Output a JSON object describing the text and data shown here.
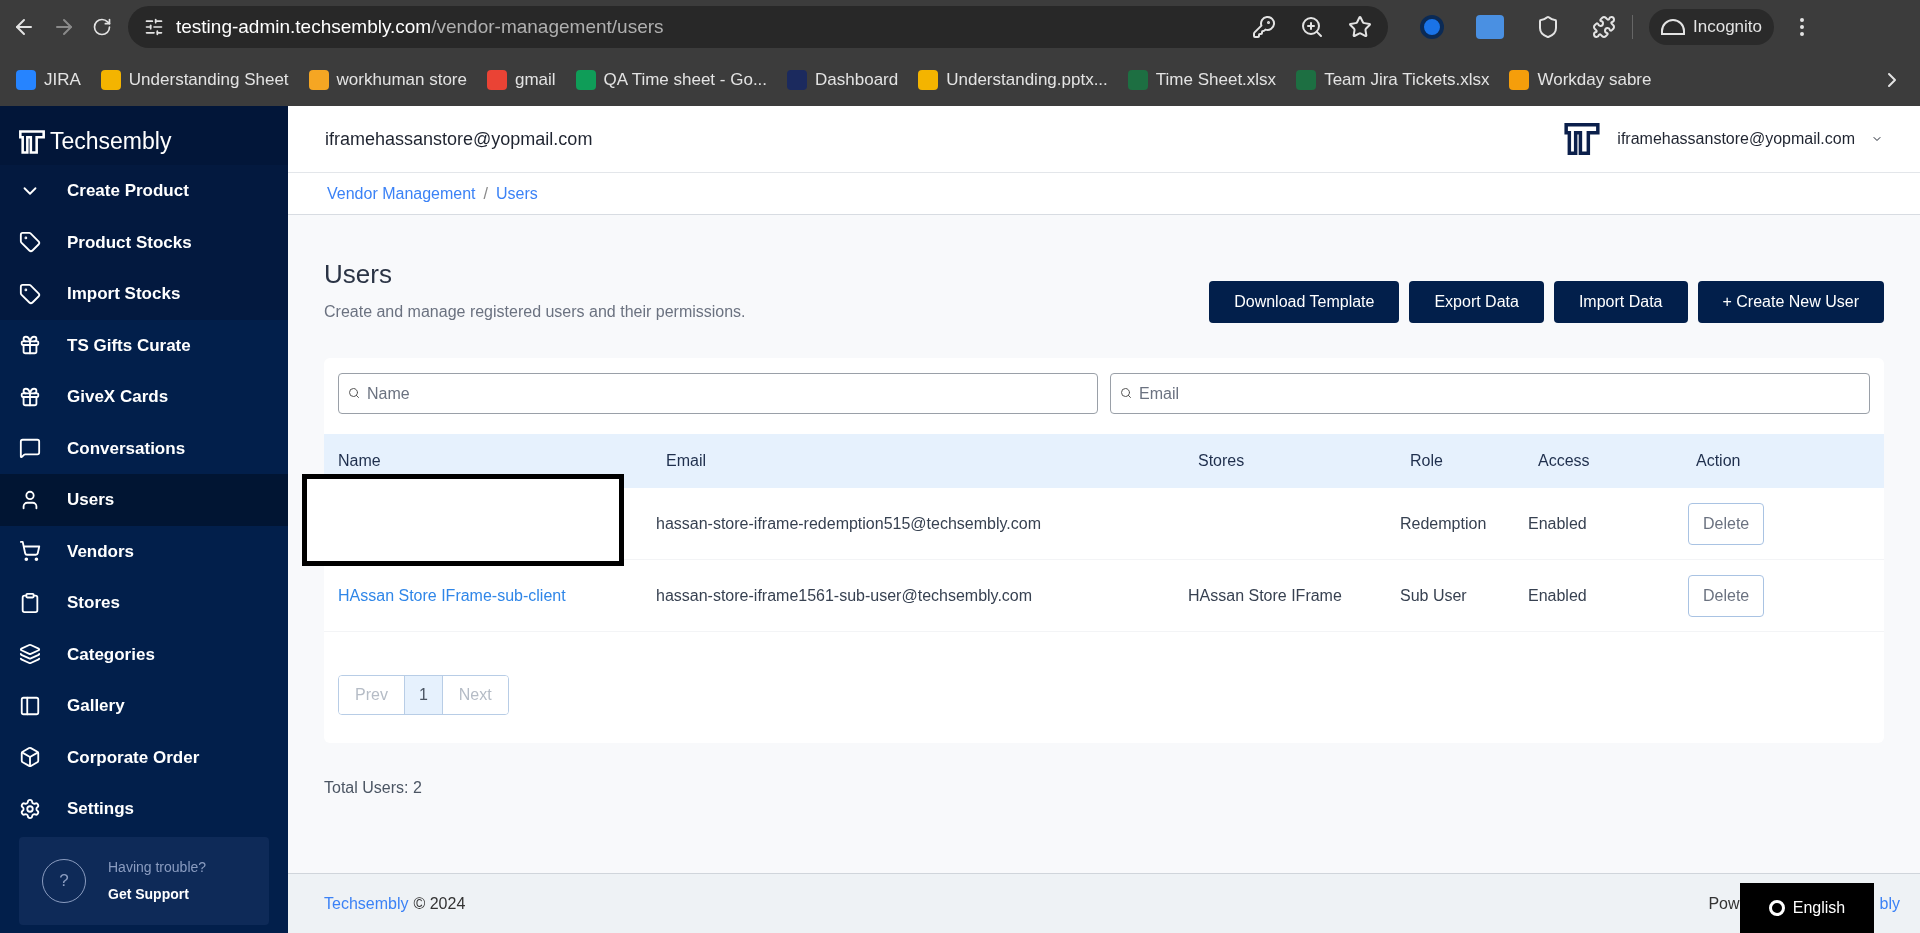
{
  "browser": {
    "url_host": "testing-admin.techsembly.com",
    "url_path": "/vendor-management/users",
    "profile": "Incognito",
    "bookmarks": [
      "JIRA",
      "Understanding Sheet",
      "workhuman store",
      "gmail",
      "QA Time sheet - Go...",
      "Dashboard",
      "Understanding.pptx...",
      "Time Sheet.xlsx",
      "Team Jira Tickets.xlsx",
      "Workday sabre"
    ]
  },
  "sidebar": {
    "brand": "Techsembly",
    "items": [
      {
        "label": "Create Product",
        "in_submenu": true,
        "selected": false
      },
      {
        "label": "Product Stocks",
        "in_submenu": true,
        "selected": false
      },
      {
        "label": "Import Stocks",
        "in_submenu": true,
        "selected": false
      },
      {
        "label": "TS Gifts Curate",
        "in_submenu": false,
        "selected": false
      },
      {
        "label": "GiveX Cards",
        "in_submenu": false,
        "selected": false
      },
      {
        "label": "Conversations",
        "in_submenu": false,
        "selected": false
      },
      {
        "label": "Users",
        "in_submenu": false,
        "selected": true
      },
      {
        "label": "Vendors",
        "in_submenu": false,
        "selected": false
      },
      {
        "label": "Stores",
        "in_submenu": false,
        "selected": false
      },
      {
        "label": "Categories",
        "in_submenu": false,
        "selected": false
      },
      {
        "label": "Gallery",
        "in_submenu": false,
        "selected": false
      },
      {
        "label": "Corporate Order",
        "in_submenu": false,
        "selected": false
      },
      {
        "label": "Settings",
        "in_submenu": false,
        "selected": false
      }
    ],
    "support": {
      "icon_text": "?",
      "title": "Having trouble?",
      "link": "Get Support"
    }
  },
  "header": {
    "account": "iframehassanstore@yopmail.com",
    "user_menu": "iframehassanstore@yopmail.com"
  },
  "breadcrumb": {
    "separator": "/",
    "items": [
      "Vendor Management",
      "Users"
    ]
  },
  "page": {
    "title": "Users",
    "subtitle": "Create and manage registered users and their permissions.",
    "buttons": [
      "Download Template",
      "Export Data",
      "Import Data",
      "+ Create New User"
    ]
  },
  "filters": [
    {
      "placeholder": "Name"
    },
    {
      "placeholder": "Email"
    }
  ],
  "table": {
    "columns": [
      "Name",
      "Email",
      "Stores",
      "Role",
      "Access",
      "Action"
    ],
    "rows": [
      {
        "redacted": true,
        "email": "hassan-store-iframe-redemption515@techsembly.com",
        "role": "Redemption",
        "access": "Enabled",
        "action": "Delete"
      },
      {
        "redacted": false,
        "name": "HAssan Store IFrame-sub-client",
        "email": "hassan-store-iframe1561-sub-user@techsembly.com",
        "stores": "HAssan Store IFrame",
        "role": "Sub User",
        "access": "Enabled",
        "action": "Delete"
      }
    ]
  },
  "pagination": [
    {
      "label": "Prev",
      "kind": "nav",
      "selected": false
    },
    {
      "label": "1",
      "kind": "page",
      "selected": true
    },
    {
      "label": "Next",
      "kind": "nav",
      "selected": false
    }
  ],
  "total": "Total Users: 2",
  "footer": {
    "brand": "Techsembly",
    "copyright": "© 2024",
    "right_start": "Pow",
    "right_end": "bly"
  },
  "language_widget": {
    "label": "English"
  }
}
